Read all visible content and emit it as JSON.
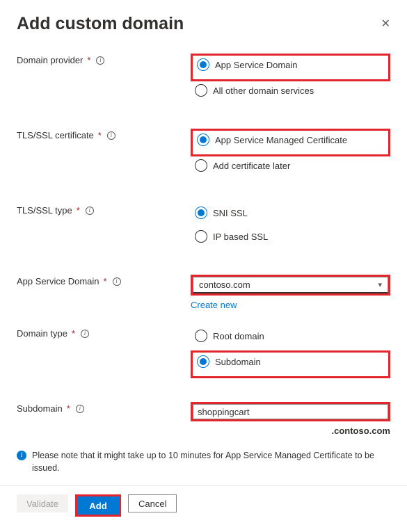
{
  "header": {
    "title": "Add custom domain"
  },
  "fields": {
    "domainProvider": {
      "label": "Domain provider",
      "options": {
        "appService": "App Service Domain",
        "other": "All other domain services"
      }
    },
    "tlsCert": {
      "label": "TLS/SSL certificate",
      "options": {
        "managed": "App Service Managed Certificate",
        "later": "Add certificate later"
      }
    },
    "tlsType": {
      "label": "TLS/SSL type",
      "options": {
        "sni": "SNI SSL",
        "ip": "IP based SSL"
      }
    },
    "appServiceDomain": {
      "label": "App Service Domain",
      "value": "contoso.com",
      "createNew": "Create new"
    },
    "domainType": {
      "label": "Domain type",
      "options": {
        "root": "Root domain",
        "sub": "Subdomain"
      }
    },
    "subdomain": {
      "label": "Subdomain",
      "value": "shoppingcart",
      "suffix": ".contoso.com"
    }
  },
  "note": "Please note that it might take up to 10 minutes for App Service Managed Certificate to be issued.",
  "footer": {
    "validate": "Validate",
    "add": "Add",
    "cancel": "Cancel"
  }
}
